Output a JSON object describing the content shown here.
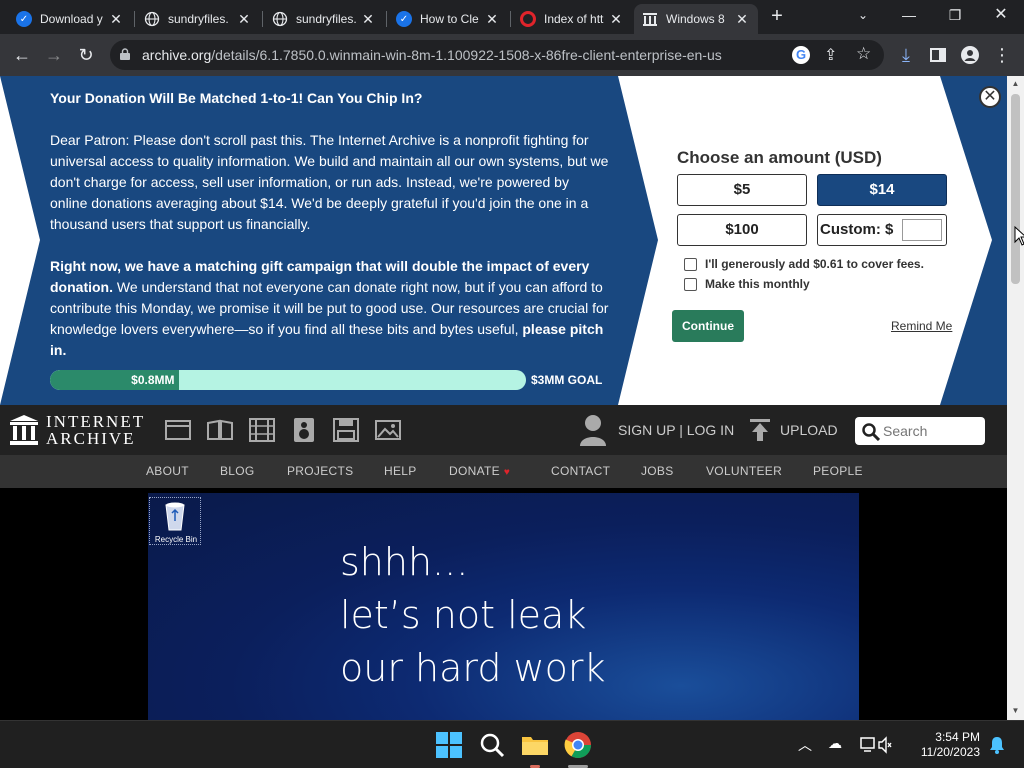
{
  "browser": {
    "tabs": [
      {
        "title": "Download y",
        "icon": "chrome-logo-icon"
      },
      {
        "title": "sundryfiles.",
        "icon": "globe-icon"
      },
      {
        "title": "sundryfiles.",
        "icon": "globe-icon"
      },
      {
        "title": "How to Cle",
        "icon": "chrome-logo-icon"
      },
      {
        "title": "Index of htt",
        "icon": "opera-logo-icon"
      },
      {
        "title": "Windows 8",
        "icon": "archive-icon"
      }
    ],
    "active_tab_index": 5,
    "url_host": "archive.org",
    "url_path": "/details/6.1.7850.0.winmain-win-8m-1.100922-1508-x-86fre-client-enterprise-en-us"
  },
  "banner": {
    "headline": "Your Donation Will Be Matched 1-to-1! Can You Chip In?",
    "para1": "Dear Patron: Please don't scroll past this. The Internet Archive is a nonprofit fighting for universal access to quality information. We build and maintain all our own systems, but we don't charge for access, sell user information, or run ads. Instead, we're powered by online donations averaging about $14. We'd be deeply grateful if you'd join the one in a thousand users that support us financially.",
    "para2_bold": "Right now, we have a matching gift campaign that will double the impact of every donation.",
    "para2_rest": " We understand that not everyone can donate right now, but if you can afford to contribute this Monday, we promise it will be put to good use. Our resources are crucial for knowledge lovers everywhere—so if you find all these bits and bytes useful, ",
    "para2_end": "please pitch in.",
    "raised": "$0.8MM",
    "goal": "$3MM GOAL",
    "progress_fraction": 0.27,
    "choose_label": "Choose an amount (USD)",
    "amounts": [
      "$5",
      "$14",
      "$100"
    ],
    "selected_amount": "$14",
    "custom_label": "Custom: $",
    "fee_label": "I'll generously add $0.61 to cover fees.",
    "monthly_label": "Make this monthly",
    "continue_label": "Continue",
    "remind_label": "Remind Me",
    "colors": {
      "blue": "#194880",
      "green": "#297b5b",
      "progress_bg": "#b5f3e3"
    }
  },
  "ia_header": {
    "logo_line1": "INTERNET",
    "logo_line2": "ARCHIVE",
    "signup_label": "SIGN UP | LOG IN",
    "upload_label": "UPLOAD",
    "search_placeholder": "Search",
    "media_icons": [
      "web-icon",
      "texts-icon",
      "video-icon",
      "audio-icon",
      "software-icon",
      "images-icon"
    ]
  },
  "subnav": [
    "ABOUT",
    "BLOG",
    "PROJECTS",
    "HELP",
    "DONATE",
    "CONTACT",
    "JOBS",
    "VOLUNTEER",
    "PEOPLE"
  ],
  "video": {
    "desktop_icon_label": "Recycle Bin",
    "line1": "shhh...",
    "line2": "let’s not leak",
    "line3": "our hard work"
  },
  "taskbar": {
    "time": "3:54 PM",
    "date": "11/20/2023"
  }
}
